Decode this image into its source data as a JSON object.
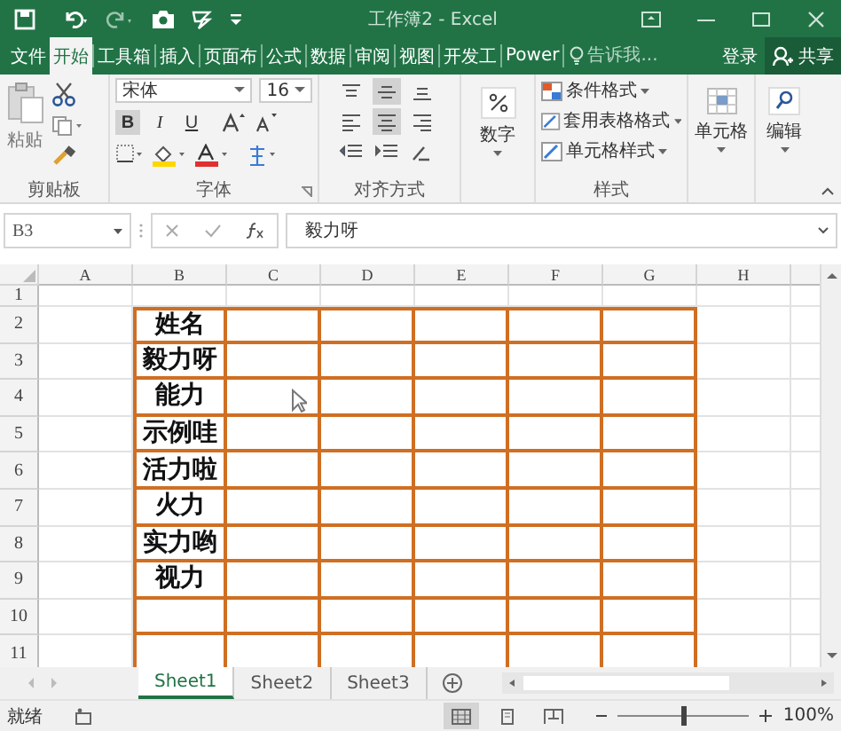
{
  "window": {
    "title": "工作簿2 - Excel"
  },
  "ribbon_tabs": [
    {
      "label": "文件",
      "selected": false
    },
    {
      "label": "开始",
      "selected": true
    },
    {
      "label": "工具箱",
      "selected": false
    },
    {
      "label": "插入",
      "selected": false
    },
    {
      "label": "页面布",
      "selected": false
    },
    {
      "label": "公式",
      "selected": false
    },
    {
      "label": "数据",
      "selected": false
    },
    {
      "label": "审阅",
      "selected": false
    },
    {
      "label": "视图",
      "selected": false
    },
    {
      "label": "开发工",
      "selected": false
    },
    {
      "label": "Power",
      "selected": false
    }
  ],
  "tell_me": {
    "placeholder": "告诉我..."
  },
  "sign_in": "登录",
  "share": "共享",
  "ribbon": {
    "clipboard": {
      "paste": "粘贴",
      "label": "剪贴板"
    },
    "font": {
      "font_name": "宋体",
      "font_size": "16",
      "format_buttons": [
        {
          "label": "B",
          "selected": true
        },
        {
          "label": "I",
          "selected": false
        },
        {
          "label": "U",
          "selected": false
        }
      ],
      "label": "字体"
    },
    "alignment": {
      "buttons": [
        {
          "kind": "top",
          "selected": false
        },
        {
          "kind": "middle",
          "selected": true
        },
        {
          "kind": "bottom",
          "selected": false
        },
        {
          "kind": "left",
          "selected": false
        },
        {
          "kind": "center",
          "selected": true
        },
        {
          "kind": "right",
          "selected": false
        }
      ],
      "label": "对齐方式"
    },
    "number": {
      "button": "数字"
    },
    "styles": {
      "buttons": [
        "条件格式",
        "套用表格格式",
        "单元格样式"
      ],
      "label": "样式"
    },
    "cells": {
      "button": "单元格"
    },
    "editing": {
      "button": "编辑"
    }
  },
  "formula_bar": {
    "name_box": "B3",
    "formula": "毅力呀"
  },
  "sheet": {
    "columns": [
      "A",
      "B",
      "C",
      "D",
      "E",
      "F",
      "G",
      "H"
    ],
    "rows": [
      {
        "number": "1",
        "bordered": false
      },
      {
        "number": "2",
        "bordered": true,
        "column_b": "姓名"
      },
      {
        "number": "3",
        "bordered": true,
        "column_b": "毅力呀"
      },
      {
        "number": "4",
        "bordered": true,
        "column_b": "能力"
      },
      {
        "number": "5",
        "bordered": true,
        "column_b": "示例哇"
      },
      {
        "number": "6",
        "bordered": true,
        "column_b": "活力啦"
      },
      {
        "number": "7",
        "bordered": true,
        "column_b": "火力"
      },
      {
        "number": "8",
        "bordered": true,
        "column_b": "实力哟"
      },
      {
        "number": "9",
        "bordered": true,
        "column_b": "视力"
      },
      {
        "number": "10",
        "bordered": true
      },
      {
        "number": "11",
        "bordered": true
      }
    ]
  },
  "sheet_tabs": [
    {
      "label": "Sheet1",
      "selected": true
    },
    {
      "label": "Sheet2",
      "selected": false
    },
    {
      "label": "Sheet3",
      "selected": false
    }
  ],
  "status_bar": {
    "status": "就绪",
    "views": [
      {
        "kind": "normal",
        "selected": true
      },
      {
        "kind": "page-layout",
        "selected": false
      },
      {
        "kind": "page-break",
        "selected": false
      }
    ],
    "zoom": {
      "level": 0.5,
      "reading": "100%"
    }
  }
}
